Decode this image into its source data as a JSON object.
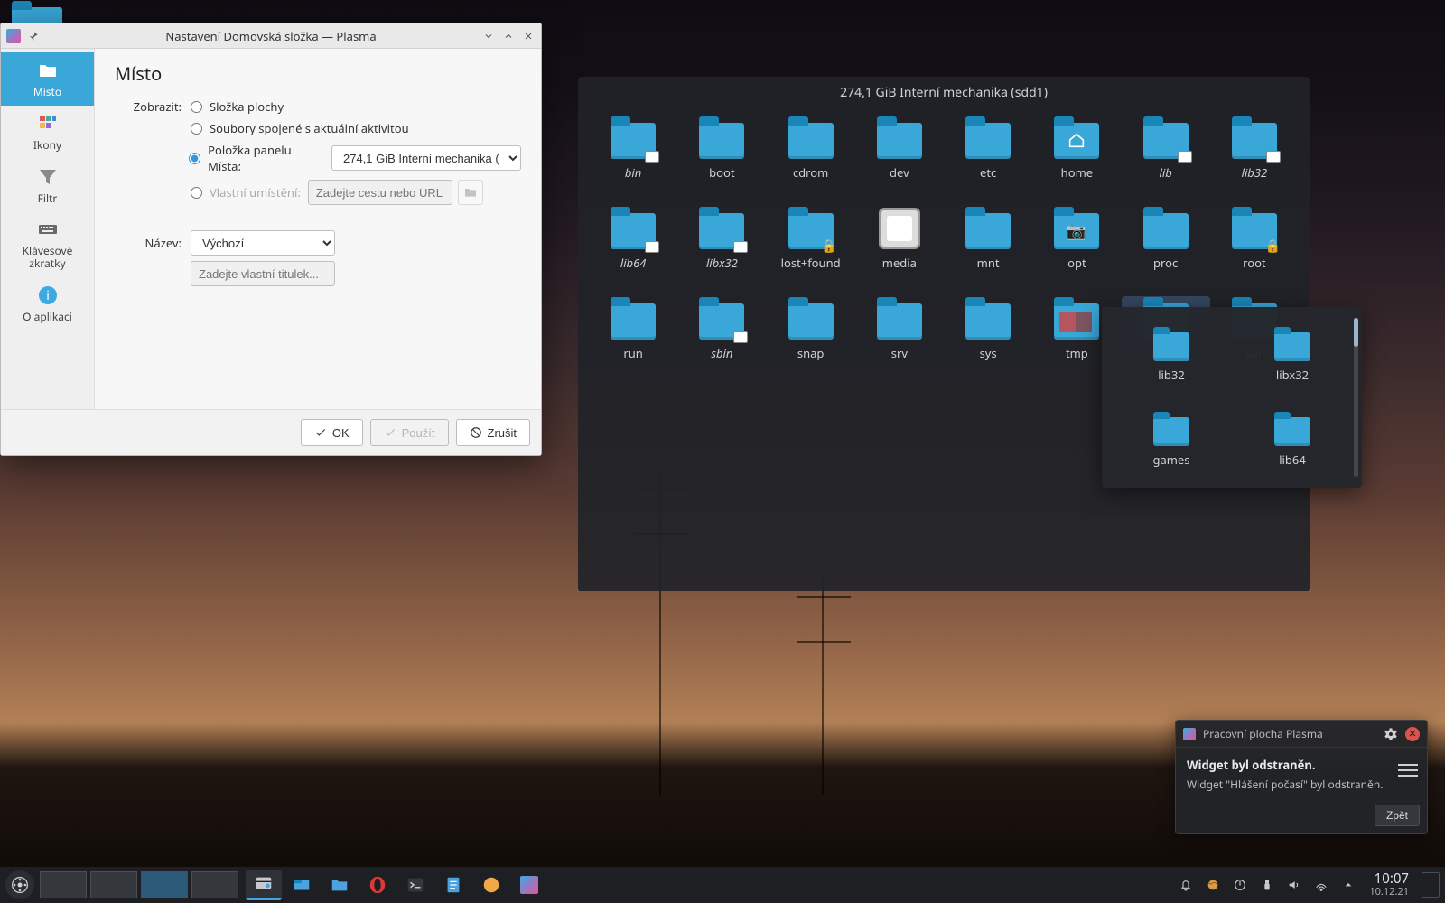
{
  "desktop": {
    "trash_name": "trash-folder-icon"
  },
  "settings": {
    "title": "Nastavení Domovská složka — Plasma",
    "sidebar": [
      {
        "label": "Místo",
        "active": true
      },
      {
        "label": "Ikony"
      },
      {
        "label": "Filtr"
      },
      {
        "label": "Klávesové zkratky"
      },
      {
        "label": "O aplikaci"
      }
    ],
    "heading": "Místo",
    "show_label": "Zobrazit:",
    "radios": {
      "desktop": "Složka plochy",
      "activity": "Soubory spojené s aktuální aktivitou",
      "places": "Položka panelu Místa:",
      "custom": "Vlastní umístění:"
    },
    "places_value": "274,1 GiB Interní mechanika (sdd1)",
    "custom_placeholder": "Zadejte cestu nebo URL",
    "name_label": "Název:",
    "name_value": "Výchozí",
    "name_placeholder": "Zadejte vlastní titulek...",
    "buttons": {
      "ok": "OK",
      "apply": "Použít",
      "cancel": "Zrušit"
    }
  },
  "folderview": {
    "title": "274,1 GiB Interní mechanika (sdd1)",
    "items": [
      {
        "label": "bin",
        "italic": true,
        "symlink": true
      },
      {
        "label": "boot",
        "italic": false
      },
      {
        "label": "cdrom",
        "italic": false
      },
      {
        "label": "dev",
        "italic": false
      },
      {
        "label": "etc",
        "italic": false
      },
      {
        "label": "home",
        "italic": false,
        "variant": "home"
      },
      {
        "label": "lib",
        "italic": true,
        "symlink": true
      },
      {
        "label": "lib32",
        "italic": true,
        "symlink": true
      },
      {
        "label": "lib64",
        "italic": true,
        "symlink": true
      },
      {
        "label": "libx32",
        "italic": true,
        "symlink": true
      },
      {
        "label": "lost+found",
        "italic": false,
        "locked": true
      },
      {
        "label": "media",
        "italic": false,
        "variant": "media"
      },
      {
        "label": "mnt",
        "italic": false
      },
      {
        "label": "opt",
        "italic": false,
        "variant": "opt"
      },
      {
        "label": "proc",
        "italic": false
      },
      {
        "label": "root",
        "italic": false,
        "locked": true
      },
      {
        "label": "run",
        "italic": false
      },
      {
        "label": "sbin",
        "italic": true,
        "symlink": true
      },
      {
        "label": "snap",
        "italic": false
      },
      {
        "label": "srv",
        "italic": false
      },
      {
        "label": "sys",
        "italic": false
      },
      {
        "label": "tmp",
        "italic": false,
        "variant": "tmp"
      },
      {
        "label": "usr",
        "italic": false,
        "selected": true
      },
      {
        "label": "var",
        "italic": false
      }
    ],
    "popup_items": [
      {
        "label": "lib32"
      },
      {
        "label": "libx32"
      },
      {
        "label": "games"
      },
      {
        "label": "lib64"
      }
    ]
  },
  "notification": {
    "app": "Pracovní plocha Plasma",
    "title": "Widget byl odstraněn.",
    "body": "Widget \"Hlášení počasí\" byl odstraněn.",
    "undo": "Zpět"
  },
  "taskbar": {
    "clock_time": "10:07",
    "clock_date": "10.12.21"
  }
}
